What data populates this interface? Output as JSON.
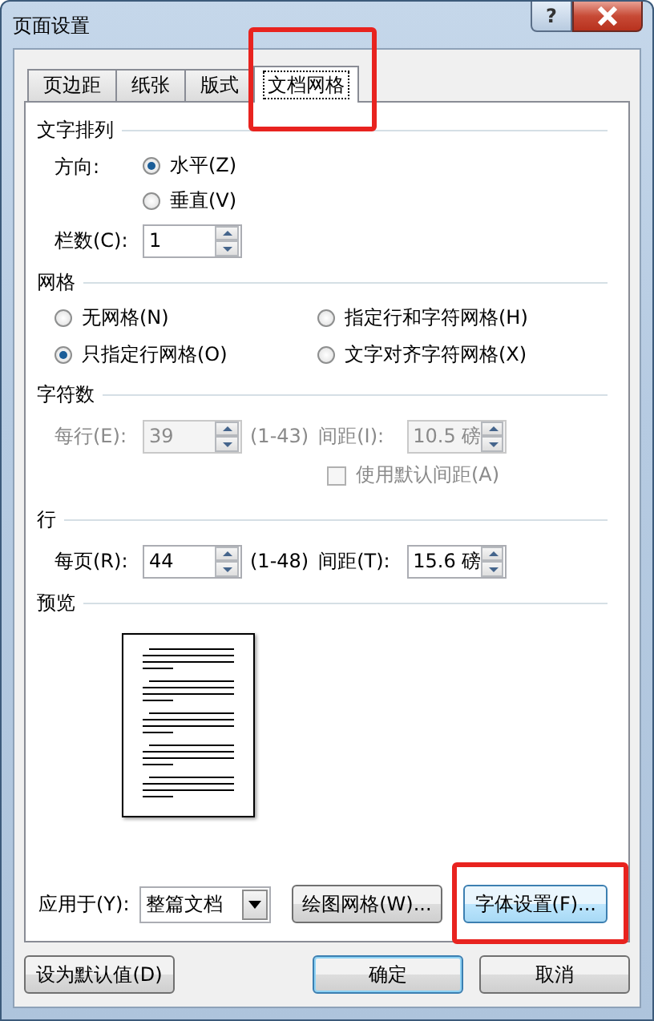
{
  "window": {
    "title": "页面设置",
    "help": "?"
  },
  "tabs": [
    {
      "label": "页边距",
      "selected": false,
      "highlighted": false
    },
    {
      "label": "纸张",
      "selected": false,
      "highlighted": false
    },
    {
      "label": "版式",
      "selected": false,
      "highlighted": false
    },
    {
      "label": "文档网格",
      "selected": true,
      "highlighted": true
    }
  ],
  "text_direction": {
    "heading": "文字排列",
    "label": "方向:",
    "options": [
      {
        "label": "水平(Z)",
        "selected": true
      },
      {
        "label": "垂直(V)",
        "selected": false
      }
    ],
    "columns": {
      "label": "栏数(C):",
      "value": "1"
    }
  },
  "grid": {
    "heading": "网格",
    "options": [
      {
        "label": "无网格(N)",
        "selected": false
      },
      {
        "label": "指定行和字符网格(H)",
        "selected": false
      },
      {
        "label": "只指定行网格(O)",
        "selected": true
      },
      {
        "label": "文字对齐字符网格(X)",
        "selected": false
      }
    ]
  },
  "characters": {
    "heading": "字符数",
    "disabled": true,
    "count": {
      "label": "每行(E):",
      "value": "39",
      "range": "(1-43)"
    },
    "spacing": {
      "label": "间距(I):",
      "value": "10.5 磅"
    },
    "default_spacing": {
      "label": "使用默认间距(A)",
      "checked": false
    }
  },
  "lines": {
    "heading": "行",
    "disabled": false,
    "count": {
      "label": "每页(R):",
      "value": "44",
      "range": "(1-48)"
    },
    "spacing": {
      "label": "间距(T):",
      "value": "15.6 磅"
    }
  },
  "preview": {
    "heading": "预览"
  },
  "apply_to": {
    "label": "应用于(Y):",
    "value": "整篇文档"
  },
  "panel_buttons": [
    {
      "label": "绘图网格(W)...",
      "highlighted": false
    },
    {
      "label": "字体设置(F)...",
      "highlighted": true
    }
  ],
  "footer_buttons": [
    {
      "label": "设为默认值(D)",
      "kind": "plain"
    },
    {
      "label": "确定",
      "kind": "default"
    },
    {
      "label": "取消",
      "kind": "plain"
    }
  ]
}
